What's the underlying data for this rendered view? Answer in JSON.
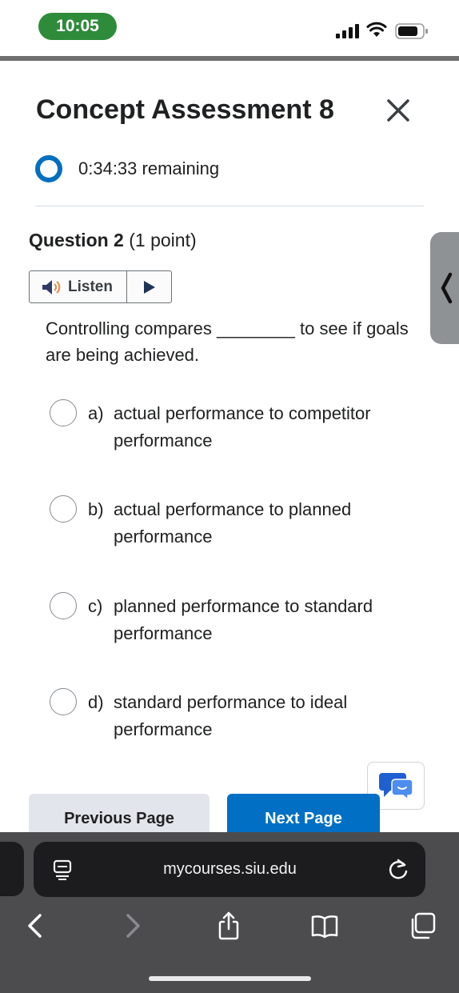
{
  "status_bar": {
    "time": "10:05",
    "icons": [
      "signal-icon",
      "wifi-icon",
      "battery-icon"
    ]
  },
  "header": {
    "title": "Concept Assessment 8",
    "close_icon": "close-icon",
    "timer_text": "0:34:33 remaining"
  },
  "question": {
    "label": "Question 2",
    "points": "(1 point)",
    "listen_label": "Listen",
    "text": "Controlling compares ________ to see if goals are being achieved.",
    "options": [
      {
        "letter": "a)",
        "text": "actual performance to competitor performance"
      },
      {
        "letter": "b)",
        "text": "actual performance to planned performance"
      },
      {
        "letter": "c)",
        "text": "planned performance to standard performance"
      },
      {
        "letter": "d)",
        "text": "standard performance to ideal performance"
      }
    ]
  },
  "navigation": {
    "previous_label": "Previous Page",
    "next_label": "Next Page"
  },
  "browser": {
    "url": "mycourses.siu.edu"
  },
  "colors": {
    "accent": "#006fc4",
    "status_pill": "#2e8b3a",
    "chrome": "#4c4c4f"
  }
}
